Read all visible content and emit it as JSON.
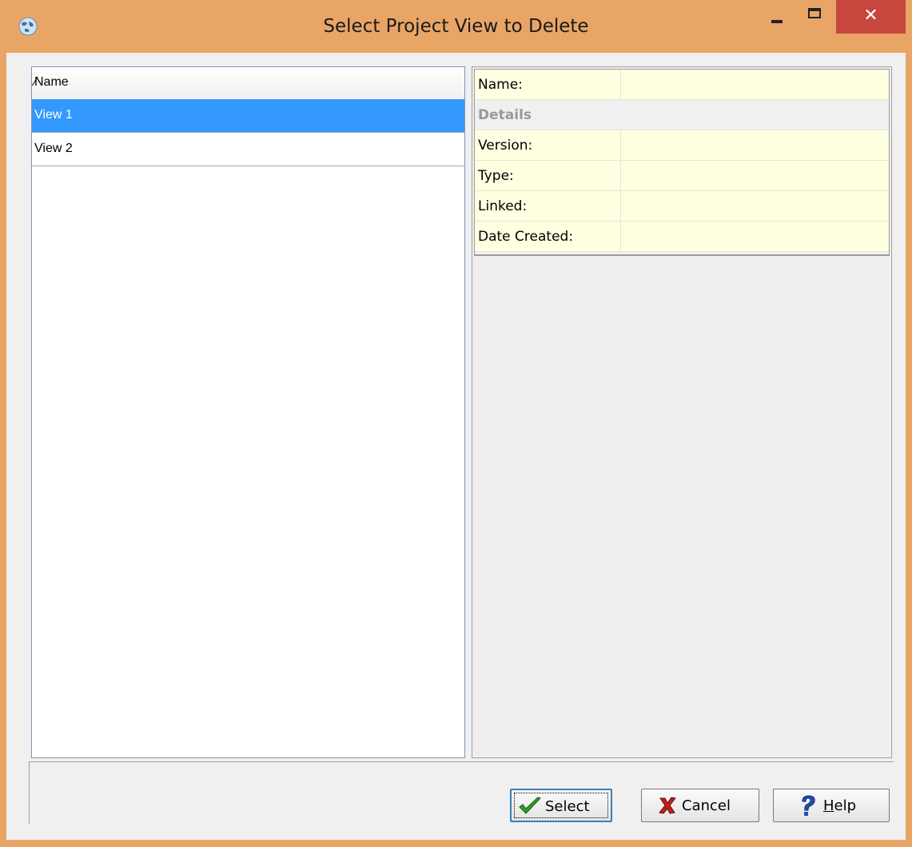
{
  "window": {
    "title": "Select Project View to Delete",
    "close_glyph": "✕",
    "accent": "#e9a566"
  },
  "list": {
    "column_header": "Name",
    "sort_glyph": "∕",
    "rows": [
      "View 1",
      "View 2"
    ],
    "selected_index": 0
  },
  "properties": {
    "name_label": "Name:",
    "details_category": "Details",
    "version_label": "Version:",
    "type_label": "Type:",
    "linked_label": "Linked:",
    "date_created_label": "Date Created:"
  },
  "buttons": {
    "select": "Select",
    "cancel": "Cancel",
    "help": "Help",
    "help_accel": "H",
    "help_rest": "elp"
  },
  "icons": {
    "app": "globe-icon",
    "select": "checkmark-icon",
    "cancel": "x-icon",
    "help": "question-icon"
  }
}
